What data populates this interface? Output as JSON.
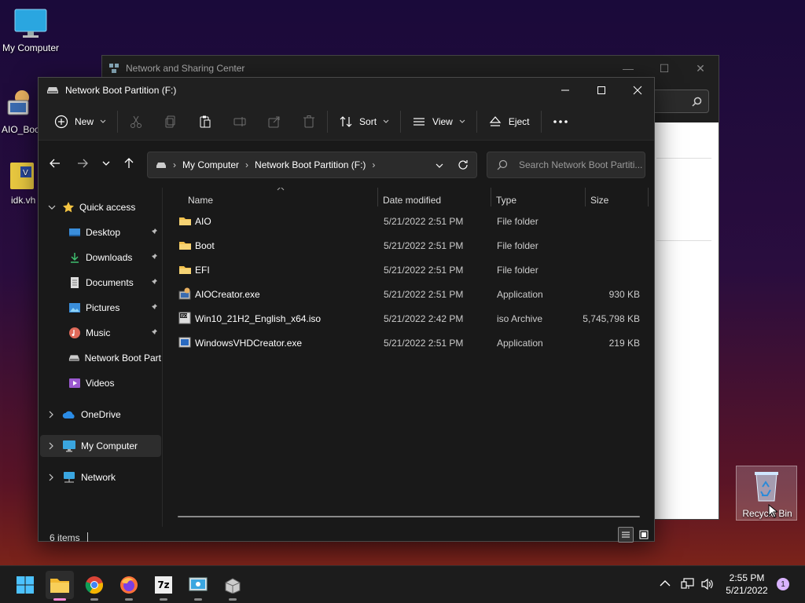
{
  "desktop": {
    "icons": [
      {
        "label": "My Computer",
        "icon": "monitor-icon"
      },
      {
        "label": "AIO_Boo",
        "icon": "aio-app-icon"
      },
      {
        "label": "idk.vh",
        "icon": "vhd-file-icon"
      }
    ],
    "recycle_bin_label": "Recycle Bin"
  },
  "back_window": {
    "title": "Network and Sharing Center"
  },
  "explorer": {
    "title": "Network Boot Partition (F:)",
    "toolbar": {
      "new_label": "New",
      "sort_label": "Sort",
      "view_label": "View",
      "eject_label": "Eject"
    },
    "breadcrumb": [
      "My Computer",
      "Network Boot Partition (F:)"
    ],
    "search_placeholder": "Search Network Boot Partiti...",
    "nav": {
      "quick_access": "Quick access",
      "items": [
        "Desktop",
        "Downloads",
        "Documents",
        "Pictures",
        "Music",
        "Network Boot Part",
        "Videos"
      ],
      "onedrive": "OneDrive",
      "my_computer": "My Computer",
      "network": "Network"
    },
    "columns": {
      "name": "Name",
      "date": "Date modified",
      "type": "Type",
      "size": "Size"
    },
    "files": [
      {
        "name": "AIO",
        "date": "5/21/2022 2:51 PM",
        "type": "File folder",
        "size": "",
        "icon": "folder-icon"
      },
      {
        "name": "Boot",
        "date": "5/21/2022 2:51 PM",
        "type": "File folder",
        "size": "",
        "icon": "folder-icon"
      },
      {
        "name": "EFI",
        "date": "5/21/2022 2:51 PM",
        "type": "File folder",
        "size": "",
        "icon": "folder-icon"
      },
      {
        "name": "AIOCreator.exe",
        "date": "5/21/2022 2:51 PM",
        "type": "Application",
        "size": "930 KB",
        "icon": "app-icon"
      },
      {
        "name": "Win10_21H2_English_x64.iso",
        "date": "5/21/2022 2:42 PM",
        "type": "iso Archive",
        "size": "5,745,798 KB",
        "icon": "iso-icon"
      },
      {
        "name": "WindowsVHDCreator.exe",
        "date": "5/21/2022 2:51 PM",
        "type": "Application",
        "size": "219 KB",
        "icon": "app-icon"
      }
    ],
    "status": "6 items"
  },
  "taskbar": {
    "time": "2:55 PM",
    "date": "5/21/2022",
    "notification_count": "1",
    "seven_zip_label": "7z"
  },
  "colors": {
    "accent": "#4cc2ff",
    "folder": "#f2c14e",
    "window_bg": "#191919",
    "taskbar_bg": "#1c1c1c"
  }
}
